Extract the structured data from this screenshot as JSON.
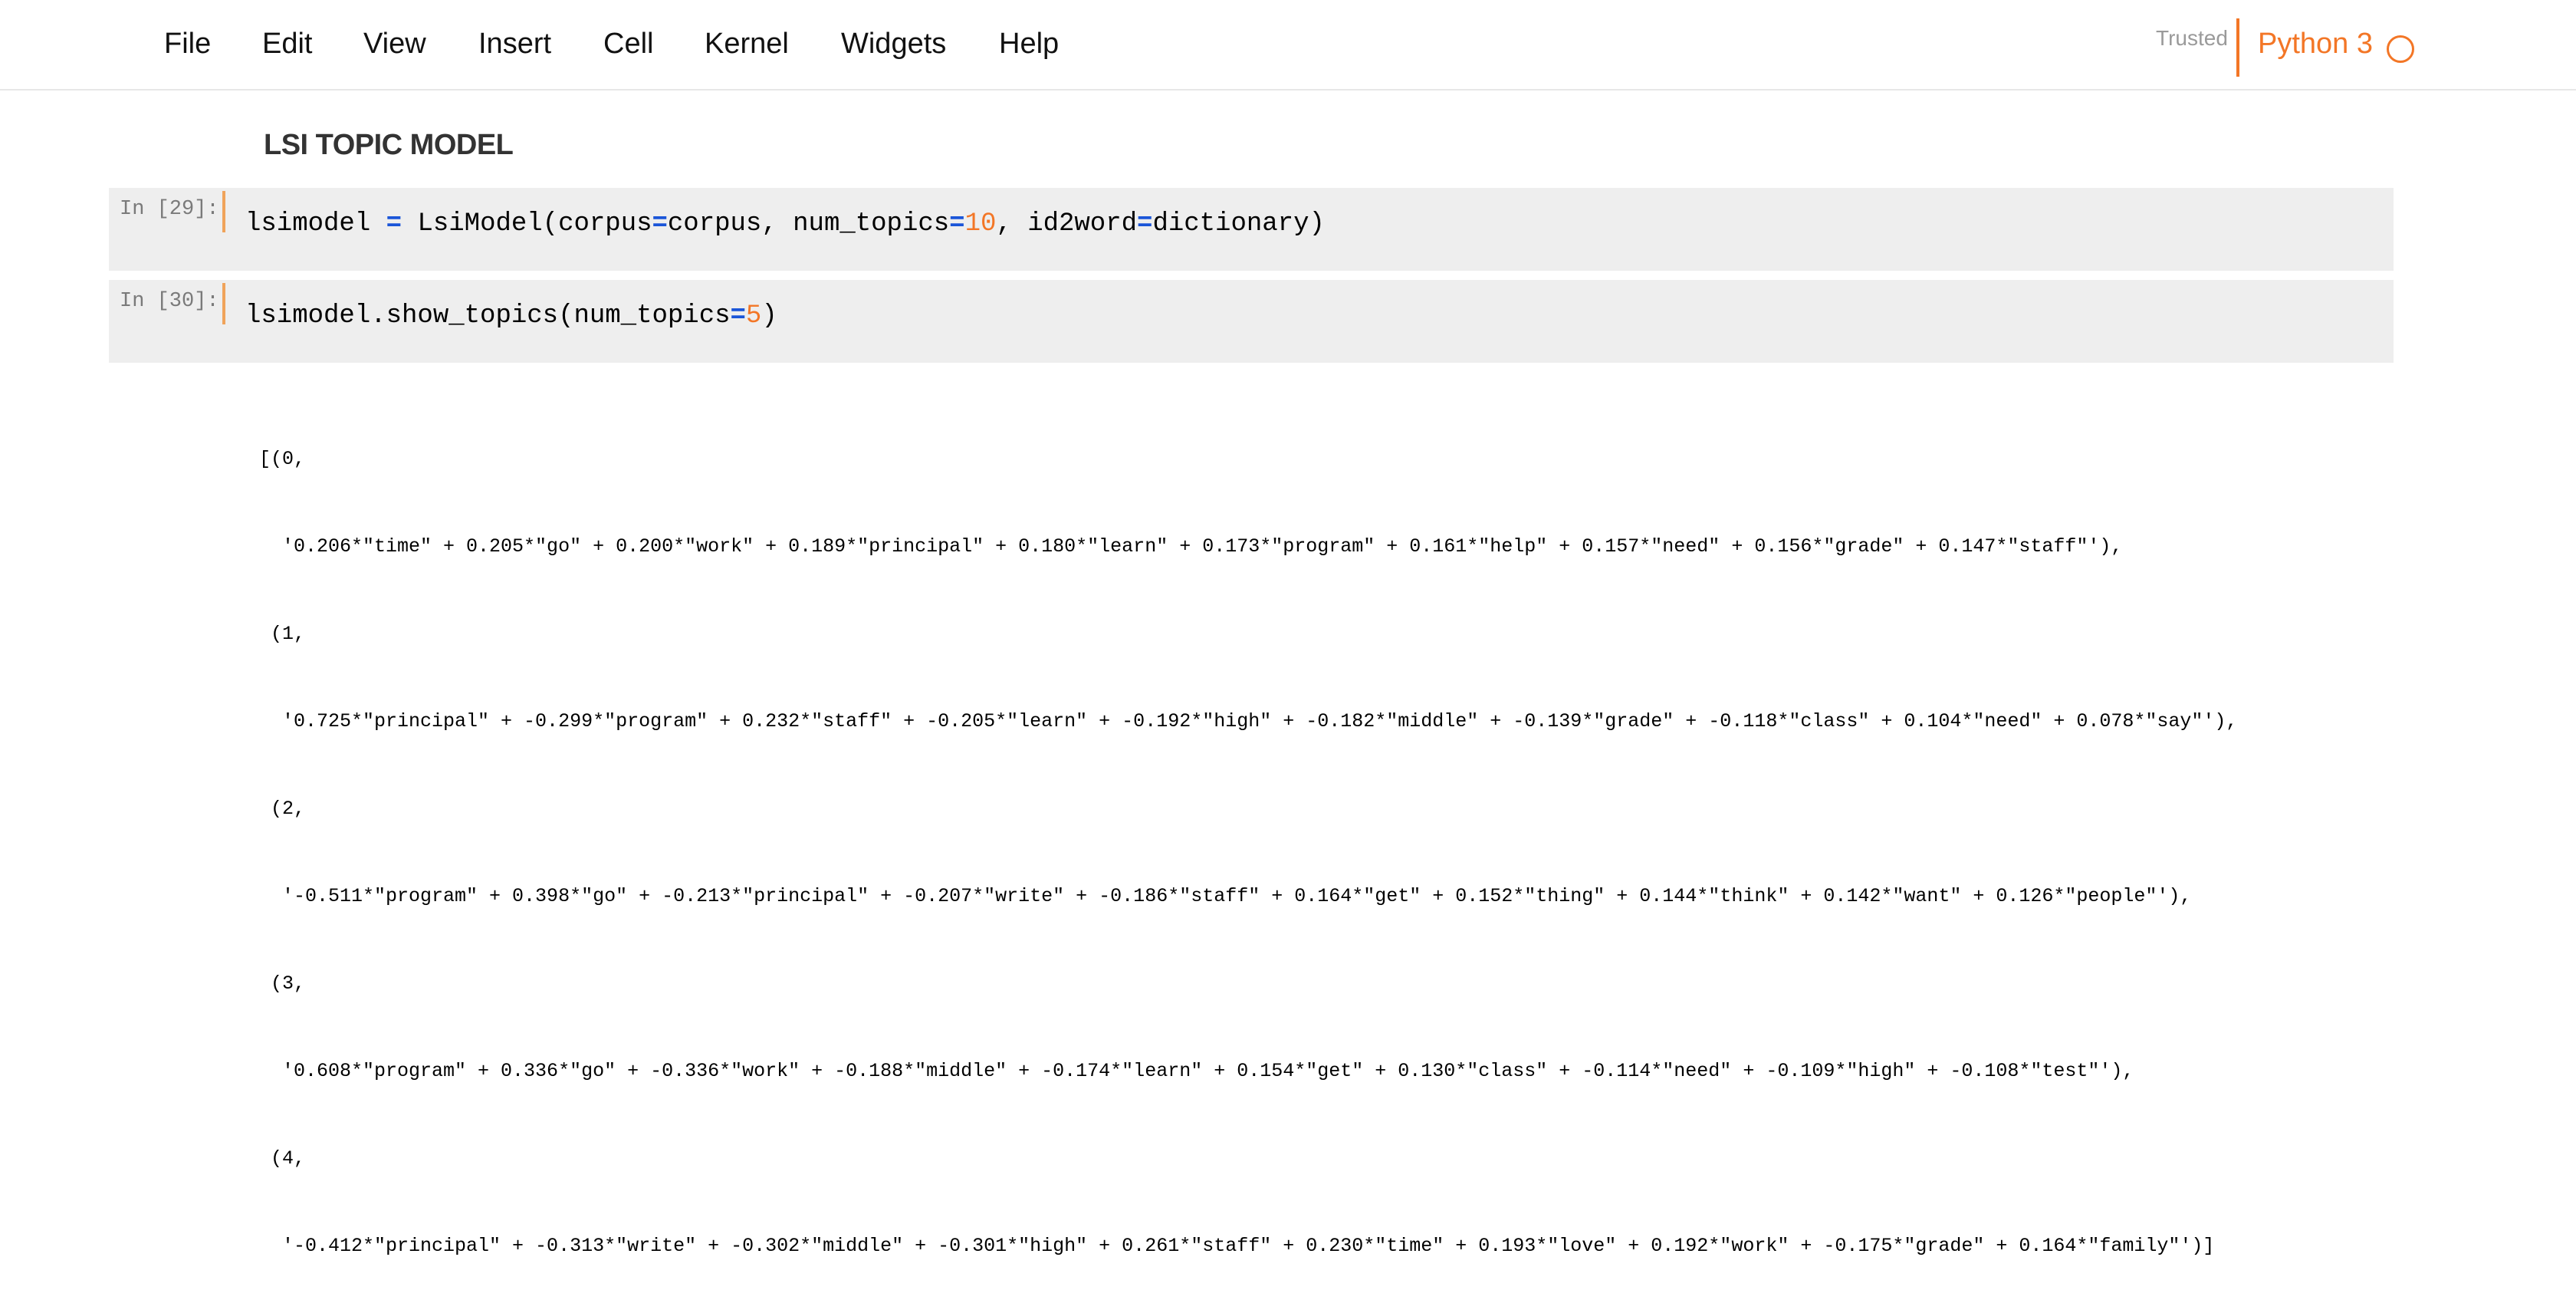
{
  "menu": {
    "items": [
      "File",
      "Edit",
      "View",
      "Insert",
      "Cell",
      "Kernel",
      "Widgets",
      "Help"
    ]
  },
  "status": {
    "trusted": "Trusted",
    "kernel": "Python 3"
  },
  "notebook": {
    "heading": "LSI TOPIC MODEL",
    "cells": [
      {
        "prompt": "In [29]:",
        "code": {
          "a": "lsimodel ",
          "b": "=",
          "c": " LsiModel(corpus",
          "d": "=",
          "e": "corpus, num_topics",
          "f": "=",
          "g": "10",
          "h": ", id2word",
          "i": "=",
          "j": "dictionary)"
        }
      },
      {
        "prompt": "In [30]:",
        "code": {
          "a": "lsimodel.show_topics(num_topics",
          "b": "=",
          "c": "5",
          "d": ")"
        }
      }
    ],
    "output_lines": [
      "[(0,",
      "  '0.206*\"time\" + 0.205*\"go\" + 0.200*\"work\" + 0.189*\"principal\" + 0.180*\"learn\" + 0.173*\"program\" + 0.161*\"help\" + 0.157*\"need\" + 0.156*\"grade\" + 0.147*\"staff\"'),",
      " (1,",
      "  '0.725*\"principal\" + -0.299*\"program\" + 0.232*\"staff\" + -0.205*\"learn\" + -0.192*\"high\" + -0.182*\"middle\" + -0.139*\"grade\" + -0.118*\"class\" + 0.104*\"need\" + 0.078*\"say\"'),",
      " (2,",
      "  '-0.511*\"program\" + 0.398*\"go\" + -0.213*\"principal\" + -0.207*\"write\" + -0.186*\"staff\" + 0.164*\"get\" + 0.152*\"thing\" + 0.144*\"think\" + 0.142*\"want\" + 0.126*\"people\"'),",
      " (3,",
      "  '0.608*\"program\" + 0.336*\"go\" + -0.336*\"work\" + -0.188*\"middle\" + -0.174*\"learn\" + 0.154*\"get\" + 0.130*\"class\" + -0.114*\"need\" + -0.109*\"high\" + -0.108*\"test\"'),",
      " (4,",
      "  '-0.412*\"principal\" + -0.313*\"write\" + -0.302*\"middle\" + -0.301*\"high\" + 0.261*\"staff\" + 0.230*\"time\" + 0.193*\"love\" + 0.192*\"work\" + -0.175*\"grade\" + 0.164*\"family\"')]"
    ]
  },
  "colors": {
    "accent": "#f37626",
    "operator": "#1a55d8",
    "cell_bg": "#eeeeee"
  }
}
